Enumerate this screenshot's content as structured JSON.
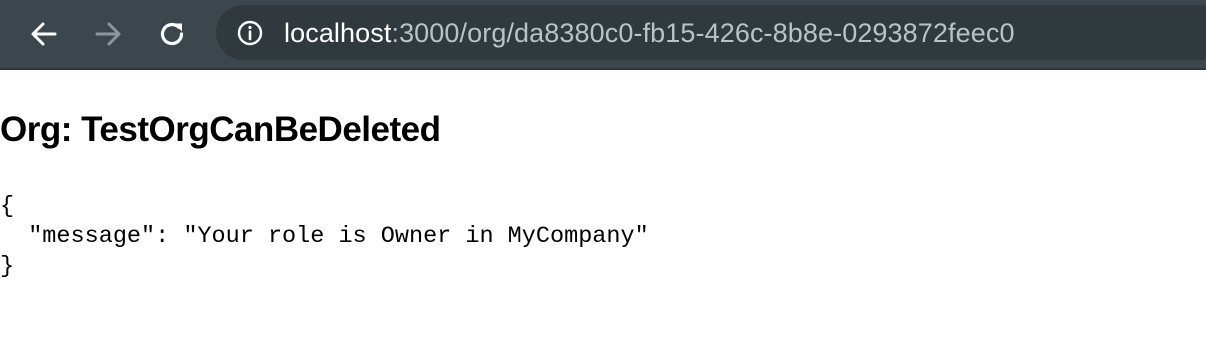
{
  "browser": {
    "url_host": "localhost",
    "url_path": ":3000/org/da8380c0-fb15-426c-8b8e-0293872feec0",
    "icons": {
      "back": "arrow-left-icon",
      "forward": "arrow-right-icon",
      "reload": "reload-icon",
      "site_info": "info-icon"
    },
    "colors": {
      "toolbar": "#3b464d",
      "omnibox": "#2f393e",
      "url_host": "#ffffff",
      "url_path": "#b9c2c8",
      "forward_disabled": "#8c979d"
    }
  },
  "page": {
    "heading": "Org: TestOrgCanBeDeleted",
    "json_open": "{",
    "json_line": "  \"message\": \"Your role is Owner in MyCompany\"",
    "json_close": "}"
  }
}
